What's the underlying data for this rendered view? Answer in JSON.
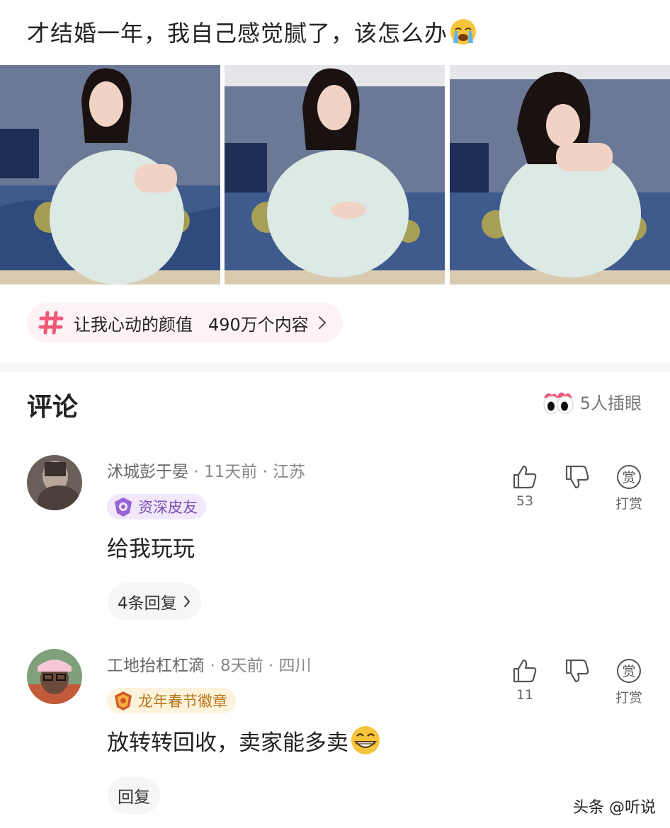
{
  "post": {
    "text": "才结婚一年，我自己感觉腻了，该怎么办",
    "emoji": "loudly-crying-face"
  },
  "topic": {
    "name": "让我心动的颜值",
    "count": "490万个内容"
  },
  "comments_section": {
    "title": "评论",
    "reactors": "5人插眼"
  },
  "comments": [
    {
      "user": "沭城彭于晏",
      "time": "11天前",
      "location": "江苏",
      "badge": "资深皮友",
      "text": "给我玩玩",
      "likes": "53",
      "tip_label": "打赏",
      "tip_icon_text": "赏",
      "reply_label": "4条回复"
    },
    {
      "user": "工地抬杠杠滴",
      "time": "8天前",
      "location": "四川",
      "badge": "龙年春节徽章",
      "text": "放转转回收，卖家能多卖",
      "likes": "11",
      "tip_label": "打赏",
      "tip_icon_text": "赏",
      "reply_label": "回复"
    }
  ],
  "separator": "·",
  "watermark": "头条 @听说",
  "colors": {
    "accent_pink": "#f0587a",
    "badge_purple_bg": "#f1e8fb",
    "badge_purple_text": "#7b4fb0",
    "badge_gold_bg": "#fdf3dc",
    "badge_gold_text": "#b8761a"
  }
}
